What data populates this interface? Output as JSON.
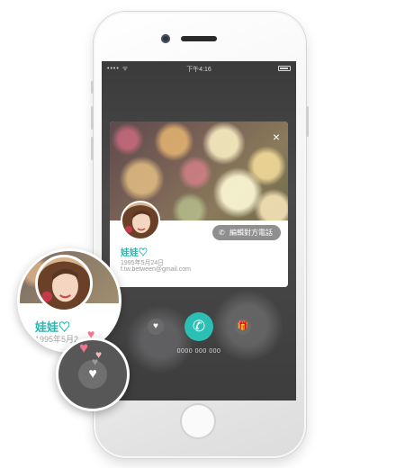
{
  "status_bar": {
    "carrier": "•••• ᯤ",
    "time": "下午4:16"
  },
  "dialog": {
    "close_glyph": "×",
    "edit_button": {
      "icon_glyph": "✆",
      "label": "編輯對方電話"
    },
    "contact": {
      "name": "娃娃♡",
      "birthday": "1995年5月24日",
      "email": "f.tw.between@gmail.com"
    }
  },
  "call_controls": {
    "heart_glyph": "♥",
    "call_glyph": "✆",
    "gift_glyph": "🎁",
    "number": "0000 000 000"
  },
  "zoom_profile": {
    "name": "娃娃♡",
    "birthday": "1995年5月2"
  },
  "zoom_heart": {
    "glyph": "♥",
    "floating_hearts": [
      "♥",
      "♥",
      "♥",
      "♥"
    ]
  },
  "colors": {
    "accent": "#2cc0b5",
    "name_text": "#29b6b0",
    "heart_pink": "#f3748c",
    "edit_button": "#8f8f8f"
  }
}
